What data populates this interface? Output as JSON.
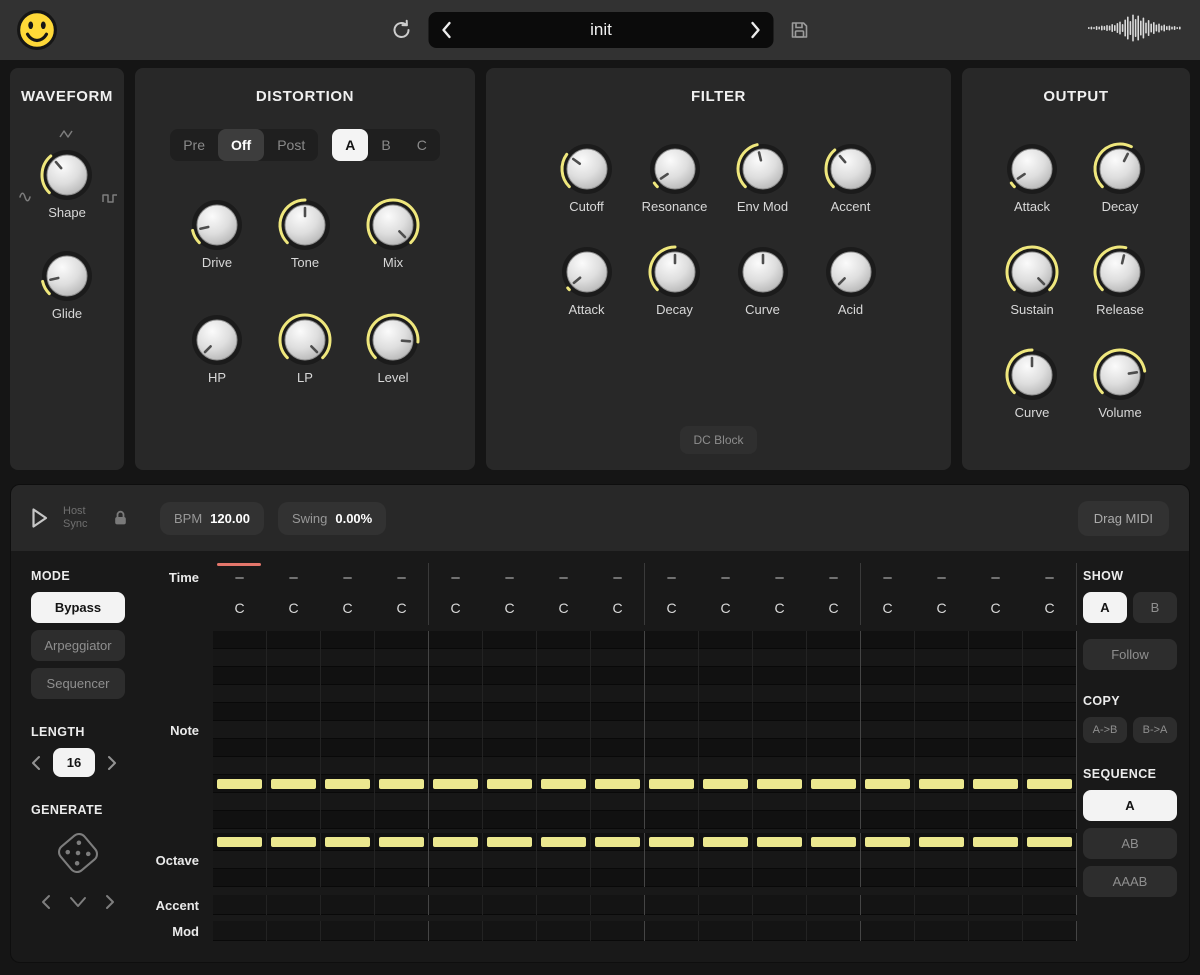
{
  "theme": {
    "accent": "#efe77d",
    "bar_color": "#ece88f",
    "playhead_color": "#e4766b",
    "selected_bg": "#f3f3f3"
  },
  "titlebar": {
    "preset_name": "init"
  },
  "panels": {
    "waveform": {
      "title": "WAVEFORM",
      "knobs": [
        {
          "label": "Shape",
          "value": 0.35
        },
        {
          "label": "Glide",
          "value": 0.12
        }
      ]
    },
    "distortion": {
      "title": "DISTORTION",
      "mode_group": {
        "options": [
          "Pre",
          "Off",
          "Post"
        ],
        "selected": "Off",
        "selected_style": "dark"
      },
      "slot_group": {
        "options": [
          "A",
          "B",
          "C"
        ],
        "selected": "A",
        "selected_style": "light"
      },
      "knob_row1": [
        {
          "label": "Drive",
          "value": 0.12
        },
        {
          "label": "Tone",
          "value": 0.5
        },
        {
          "label": "Mix",
          "value": 1
        }
      ],
      "knob_row2": [
        {
          "label": "HP",
          "value": 0
        },
        {
          "label": "LP",
          "value": 1
        },
        {
          "label": "Level",
          "value": 0.85
        }
      ]
    },
    "filter": {
      "title": "FILTER",
      "knob_row1": [
        {
          "label": "Cutoff",
          "value": 0.3
        },
        {
          "label": "Resonance",
          "value": 0.04
        },
        {
          "label": "Env Mod",
          "value": 0.45
        },
        {
          "label": "Accent",
          "value": 0.35
        }
      ],
      "knob_row2": [
        {
          "label": "Attack",
          "value": 0.02
        },
        {
          "label": "Decay",
          "value": 0.5
        },
        {
          "label": "Curve",
          "value": 0.5,
          "bipolar": true
        },
        {
          "label": "Acid",
          "value": 0
        }
      ],
      "dc_block_label": "DC Block"
    },
    "output": {
      "title": "OUTPUT",
      "knob_row1": [
        {
          "label": "Attack",
          "value": 0.04
        },
        {
          "label": "Decay",
          "value": 0.6
        }
      ],
      "knob_row2": [
        {
          "label": "Sustain",
          "value": 1
        },
        {
          "label": "Release",
          "value": 0.55
        }
      ],
      "knob_row3": [
        {
          "label": "Curve",
          "value": 0.5
        },
        {
          "label": "Volume",
          "value": 0.8
        }
      ]
    }
  },
  "sequencer": {
    "toolbar": {
      "host_sync": "Host Sync",
      "bpm_label": "BPM",
      "bpm_value": "120.00",
      "swing_label": "Swing",
      "swing_value": "0.00%",
      "drag_midi": "Drag MIDI"
    },
    "mode": {
      "heading": "MODE",
      "options": [
        "Bypass",
        "Arpeggiator",
        "Sequencer"
      ],
      "selected": "Bypass"
    },
    "length": {
      "heading": "LENGTH",
      "value": "16"
    },
    "generate": {
      "heading": "GENERATE"
    },
    "grid": {
      "steps": 16,
      "row_labels": {
        "time": "Time",
        "note": "Note",
        "octave": "Octave",
        "accent": "Accent",
        "mod": "Mod"
      },
      "time": [
        "–",
        "–",
        "–",
        "–",
        "–",
        "–",
        "–",
        "–",
        "–",
        "–",
        "–",
        "–",
        "–",
        "–",
        "–",
        "–"
      ],
      "note_names": [
        "C",
        "C",
        "C",
        "C",
        "C",
        "C",
        "C",
        "C",
        "C",
        "C",
        "C",
        "C",
        "C",
        "C",
        "C",
        "C"
      ],
      "note_rows": 11,
      "active_note_row": 8,
      "octave_rows": 3,
      "active_octave_row": 0
    },
    "show": {
      "heading": "SHOW",
      "ab": {
        "options": [
          "A",
          "B"
        ],
        "selected": "A"
      },
      "follow": "Follow"
    },
    "copy": {
      "heading": "COPY",
      "buttons": {
        "options": [
          "A->B",
          "B->A"
        ],
        "selected": null
      }
    },
    "sequence": {
      "heading": "SEQUENCE",
      "options": [
        "A",
        "AB",
        "AAAB"
      ],
      "selected": "A"
    }
  }
}
